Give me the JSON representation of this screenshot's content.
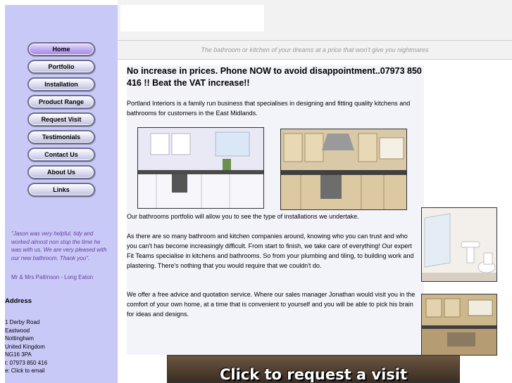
{
  "nav": {
    "items": [
      "Home",
      "Portfolio",
      "Installation",
      "Product Range",
      "Request Visit",
      "Testimonials",
      "Contact Us",
      "About Us",
      "Links"
    ],
    "active": "Home"
  },
  "testimonial": {
    "quote": "\"Jason was very helpful, tidy and worked almost non stop the time he was with us. We are very pleased with our new bathroom. Thank you\".",
    "author": "Mr & Mrs Pattinson - Long Eaton"
  },
  "address": {
    "heading": "Address",
    "lines": [
      "1 Derby Road",
      "Eastwood",
      "Nottingham",
      "United Kingdom",
      "NG16 3PA",
      "t: 07973 850 416",
      "e: Click to email"
    ]
  },
  "header": {
    "tagline": "The bathroom or kitchen of your dreams at a price that won't give you nightmares"
  },
  "main": {
    "headline": "No increase in prices. Phone NOW to avoid disappointment..07973 850 416 !! Beat the VAT increase!!",
    "intro": "Portland Interiors is a family run business that specialises in designing and fitting quality kitchens and bathrooms for customers in the East Midlands.",
    "para1": "Our bathrooms portfolio will allow you to see the type of installations we undertake.",
    "para2": "As there are so many bathroom and kitchen companies around, knowing who you can trust and who you can't has become increasingly difficult. From start to finish, we take care of everything! Our expert Fit Teams specialise in kitchens and bathrooms. So from your plumbing and tiling, to building work and plastering. There's nothing that you would require that we couldn't do.",
    "para3": "We offer a free advice and quotation service. Where our sales manager Jonathan would visit you in the comfort of your own home, at a time that is convenient to yourself and you will be able to pick his brain for ideas and designs."
  },
  "banner": {
    "label": "Click to request a visit"
  },
  "colors": {
    "sidebar": "#c9c9f7",
    "testimonial_text": "#6b38a8",
    "tagline_text": "#9a9a9a"
  }
}
